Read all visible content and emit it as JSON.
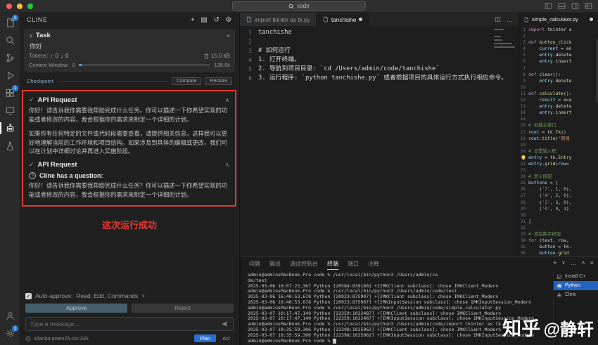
{
  "titlebar": {
    "command_center": "code"
  },
  "activity_bar": {
    "items": [
      {
        "name": "explorer",
        "badge": "1"
      },
      {
        "name": "search"
      },
      {
        "name": "source-control"
      },
      {
        "name": "run-debug"
      },
      {
        "name": "extensions",
        "badge": "1"
      },
      {
        "name": "remote"
      },
      {
        "name": "cline",
        "active": true
      },
      {
        "name": "testing"
      }
    ],
    "bottom": [
      {
        "name": "account"
      },
      {
        "name": "settings",
        "badge": "1"
      }
    ]
  },
  "cline": {
    "title": "CLINE",
    "task": {
      "label": "Task",
      "text": "你好",
      "tokens_label": "Tokens:",
      "tokens_up": "0",
      "tokens_down": "0",
      "size": "15.0 kB",
      "context_label": "Context Window:",
      "context_used": "0",
      "context_max": "128.0k"
    },
    "checkpoint": {
      "label": "Checkpoint",
      "compare": "Compare",
      "restore": "Restore"
    },
    "api_request_1": "API Request",
    "para_1a": "你好！请告诉我你需要我帮助完成什么任务。你可以描述一下你希望实现的功能或者修改的内容，我会根据你的需求来制定一个详细的计划。",
    "para_1b": "如果你有任何特定的文件或代码段需要查看，请提供相关信息，这样我可以更好地理解当前的工作环境和项目结构。如果涉及到具体的编辑或更改，我们可以在计划中详细讨论并再进入实施阶段。",
    "api_request_2": "API Request",
    "question_label": "Cline has a question:",
    "para_2": "你好！请告诉我你需要我帮助完成什么任务？你可以描述一下你希望实现的功能或者修改的内容，我会根据你的需求来制定一个详细的计划。",
    "annotation": "这次运行成功",
    "auto_approve_label": "Auto-approve:",
    "auto_approve_value": "Read, Edit, Commands",
    "approve_button": "Approve",
    "reject_button": "Reject",
    "input_placeholder": "Type a message...",
    "model": "xilanka:qwen25-ctx:32k",
    "plan_label": "Plan",
    "act_label": "Act"
  },
  "editor": {
    "tabs": [
      {
        "label": "import tkinter as tk.py"
      },
      {
        "label": "tanchishe"
      }
    ],
    "lines": [
      "tanchishe",
      "",
      "# 如何运行",
      "1. 打开终端。",
      "2. 导航到项目目录: `cd /Users/admin/code/tanchishe`",
      "3. 运行程序: `python tanchishe.py` 或者根据项目的具体运行方式执行相应命令。"
    ]
  },
  "right_editor": {
    "tab": "simple_calculator.py",
    "lines": [
      [
        [
          "k",
          "import"
        ],
        [
          "p",
          " tkinter a"
        ]
      ],
      [],
      [
        [
          "k",
          "def"
        ],
        [
          "f",
          " button_click"
        ]
      ],
      [
        [
          "p",
          "    "
        ],
        [
          "v",
          "current"
        ],
        [
          "p",
          " = en"
        ]
      ],
      [
        [
          "p",
          "    "
        ],
        [
          "v",
          "entry"
        ],
        [
          "p",
          "."
        ],
        [
          "f",
          "delete"
        ]
      ],
      [
        [
          "p",
          "    "
        ],
        [
          "v",
          "entry"
        ],
        [
          "p",
          "."
        ],
        [
          "f",
          "insert"
        ]
      ],
      [],
      [
        [
          "k",
          "def"
        ],
        [
          "f",
          " clear"
        ],
        [
          "p",
          "():"
        ]
      ],
      [
        [
          "p",
          "    "
        ],
        [
          "v",
          "entry"
        ],
        [
          "p",
          "."
        ],
        [
          "f",
          "delete"
        ]
      ],
      [],
      [
        [
          "k",
          "def"
        ],
        [
          "f",
          " calculate"
        ],
        [
          "p",
          "():"
        ]
      ],
      [
        [
          "p",
          "    "
        ],
        [
          "v",
          "result"
        ],
        [
          "p",
          " = "
        ],
        [
          "f",
          "eva"
        ]
      ],
      [
        [
          "p",
          "    "
        ],
        [
          "v",
          "entry"
        ],
        [
          "p",
          "."
        ],
        [
          "f",
          "delete"
        ]
      ],
      [
        [
          "p",
          "    "
        ],
        [
          "v",
          "entry"
        ],
        [
          "p",
          "."
        ],
        [
          "f",
          "insert"
        ]
      ],
      [],
      [
        [
          "c",
          "# 创建主窗口"
        ]
      ],
      [
        [
          "v",
          "root"
        ],
        [
          "p",
          " = tk."
        ],
        [
          "f",
          "Tk"
        ],
        [
          "p",
          "()"
        ]
      ],
      [
        [
          "v",
          "root"
        ],
        [
          "p",
          "."
        ],
        [
          "f",
          "title"
        ],
        [
          "p",
          "("
        ],
        [
          "s",
          "\"简易"
        ]
      ],
      [],
      [
        [
          "c",
          "# 设置输入框"
        ]
      ],
      [
        [
          "v",
          "entry"
        ],
        [
          "p",
          " = tk."
        ],
        [
          "f",
          "Entry"
        ]
      ],
      [
        [
          "v",
          "entry"
        ],
        [
          "p",
          "."
        ],
        [
          "f",
          "grid"
        ],
        [
          "p",
          "("
        ],
        [
          "v",
          "row"
        ],
        [
          "p",
          "="
        ]
      ],
      [],
      [
        [
          "c",
          "# 定义按钮"
        ]
      ],
      [
        [
          "v",
          "buttons"
        ],
        [
          "p",
          " = ["
        ]
      ],
      [
        [
          "p",
          "    ("
        ],
        [
          "s",
          "'7'"
        ],
        [
          "p",
          ", "
        ],
        [
          "n",
          "1"
        ],
        [
          "p",
          ", "
        ],
        [
          "n",
          "0"
        ],
        [
          "p",
          "),"
        ]
      ],
      [
        [
          "p",
          "    ("
        ],
        [
          "s",
          "'4'"
        ],
        [
          "p",
          ", "
        ],
        [
          "n",
          "2"
        ],
        [
          "p",
          ", "
        ],
        [
          "n",
          "0"
        ],
        [
          "p",
          "),"
        ]
      ],
      [
        [
          "p",
          "    ("
        ],
        [
          "s",
          "'1'"
        ],
        [
          "p",
          ", "
        ],
        [
          "n",
          "3"
        ],
        [
          "p",
          ", "
        ],
        [
          "n",
          "0"
        ],
        [
          "p",
          "),"
        ]
      ],
      [
        [
          "p",
          "    ("
        ],
        [
          "s",
          "'0'"
        ],
        [
          "p",
          ", "
        ],
        [
          "n",
          "4"
        ],
        [
          "p",
          ", "
        ],
        [
          "n",
          "1"
        ],
        [
          "p",
          ")"
        ]
      ],
      [],
      [
        [
          "p",
          "]"
        ]
      ],
      [],
      [
        [
          "c",
          "# 添加数字按钮"
        ]
      ],
      [
        [
          "k",
          "for"
        ],
        [
          "p",
          " (text, row,"
        ]
      ],
      [
        [
          "p",
          "    "
        ],
        [
          "v",
          "button"
        ],
        [
          "p",
          " = tk."
        ]
      ],
      [
        [
          "p",
          "    "
        ],
        [
          "v",
          "button"
        ],
        [
          "p",
          "."
        ],
        [
          "f",
          "grid"
        ]
      ]
    ]
  },
  "panel": {
    "tabs": [
      "问题",
      "输出",
      "调试控制台",
      "终端",
      "端口",
      "注释"
    ],
    "active_tab": "终端",
    "terminal_lines": [
      "admin@adminsMacBook-Pro code % /usr/local/bin/python3 /Users/admin/co",
      "de/test",
      "2025-03-06 16:07:23.367 Python [20584:839160] +[IMKClient subclass]: chose IMKClient_Modern",
      "admin@adminsMacBook-Pro code % /usr/local/bin/python3 /Users/admin/code/test",
      "2025-03-06 16:40:53.678 Python [20923:875907] +[IMKClient subclass]: chose IMKClient_Modern",
      "2025-03-06 16:40:53.678 Python [20923:875907] +[IMKInputSession subclass]: chose IMKInputSession_Modern",
      "admin@adminsMacBook-Pro code % /usr/local/bin/python3 /Users/admin/code/simple_calculator.py",
      "2025-03-07 10:17:47.140 Python [22359:1022487] +[IMKClient subclass]: chose IMKClient_Modern",
      "2025-03-07 10:17:47.140 Python [22359:1022487] +[IMKInputSession subclass]: chose IMKInputSession_Modern",
      "admin@adminsMacBook-Pro code % /usr/local/bin/python3 /Users/admin/code/import tkinter as tk.py",
      "2025-03-07 10:35:59.306 Python [22398:1025062] +[IMKClient subclass]: chose IMKClient_Modern",
      "2025-03-07 10:35:59.306 Python [22398:1025062] +[IMKInputSession subclass]: chose IMKInputSession_Modern",
      "admin@adminsMacBook-Pro code % "
    ],
    "terminals": [
      {
        "icon": "task",
        "label": "Install C+"
      },
      {
        "icon": "python",
        "label": "Python",
        "active": true
      },
      {
        "icon": "cline",
        "label": "Cline"
      }
    ]
  },
  "watermark": {
    "brand": "知乎",
    "handle": "@静轩"
  }
}
